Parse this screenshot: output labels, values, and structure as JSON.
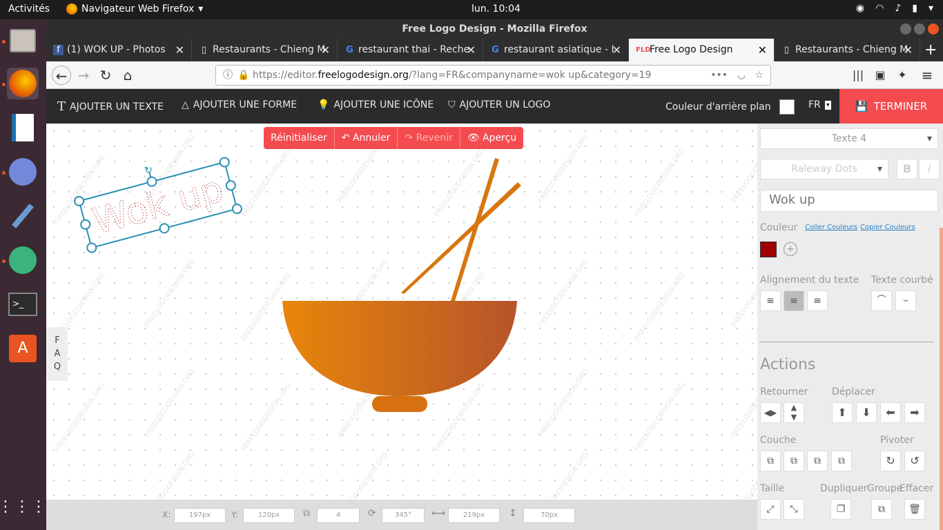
{
  "os": {
    "activities": "Activités",
    "app_menu": "Navigateur Web Firefox",
    "clock": "lun. 10:04"
  },
  "window": {
    "title": "Free Logo Design - Mozilla Firefox"
  },
  "tabs": [
    {
      "label": "(1) WOK UP - Photos",
      "icon": "facebook-icon"
    },
    {
      "label": "Restaurants - Chieng M",
      "icon": "page-icon"
    },
    {
      "label": "restaurant thai - Reche",
      "icon": "google-icon"
    },
    {
      "label": "restaurant asiatique - I",
      "icon": "google-icon"
    },
    {
      "label": "Free Logo Design",
      "icon": "fld-icon"
    },
    {
      "label": "Restaurants - Chieng M",
      "icon": "page-icon"
    }
  ],
  "url": {
    "prefix": "https://editor.",
    "domain": "freelogodesign.org",
    "suffix": "/?lang=FR&companyname=wok up&category=19"
  },
  "toolbar": {
    "add_text": "AJOUTER UN TEXTE",
    "add_shape": "AJOUTER UNE FORME",
    "add_icon": "AJOUTER UNE ICÔNE",
    "add_logo": "AJOUTER UN LOGO",
    "bg_color": "Couleur d'arrière plan",
    "lang": "FR",
    "finish": "TERMINER"
  },
  "canvas_controls": {
    "reset": "Réinitialiser",
    "undo": "Annuler",
    "redo": "Revenir",
    "preview": "Aperçu"
  },
  "canvas": {
    "logo_text": "Wok up",
    "watermark": "FREELOGODESIGN.ORG",
    "text_color": "#a00000",
    "bowl_colors": [
      "#e8860a",
      "#b6542a"
    ]
  },
  "faq": [
    "F",
    "A",
    "Q"
  ],
  "position_bar": {
    "x_label": "X:",
    "x_value": "197px",
    "y_label": "Y:",
    "y_value": "120px",
    "layer_value": "4",
    "rotation_value": "345°",
    "width_value": "219px",
    "height_value": "70px"
  },
  "panel": {
    "element": "Texte 4",
    "font": "Raleway Dots",
    "bold": "B",
    "italic": "i",
    "text_value": "Wok up",
    "color_label": "Couleur",
    "paste_colors": "Coller Couleurs",
    "copy_colors": "Copier Couleurs",
    "align_label": "Alignement du texte",
    "curve_label": "Texte courbé",
    "actions_title": "Actions",
    "flip_label": "Retourner",
    "move_label": "Déplacer",
    "layer_label": "Couche",
    "rotate_label": "Pivoter",
    "size_label": "Taille",
    "duplicate_label": "Dupliquer",
    "group_label": "Groupe",
    "delete_label": "Effacer"
  }
}
